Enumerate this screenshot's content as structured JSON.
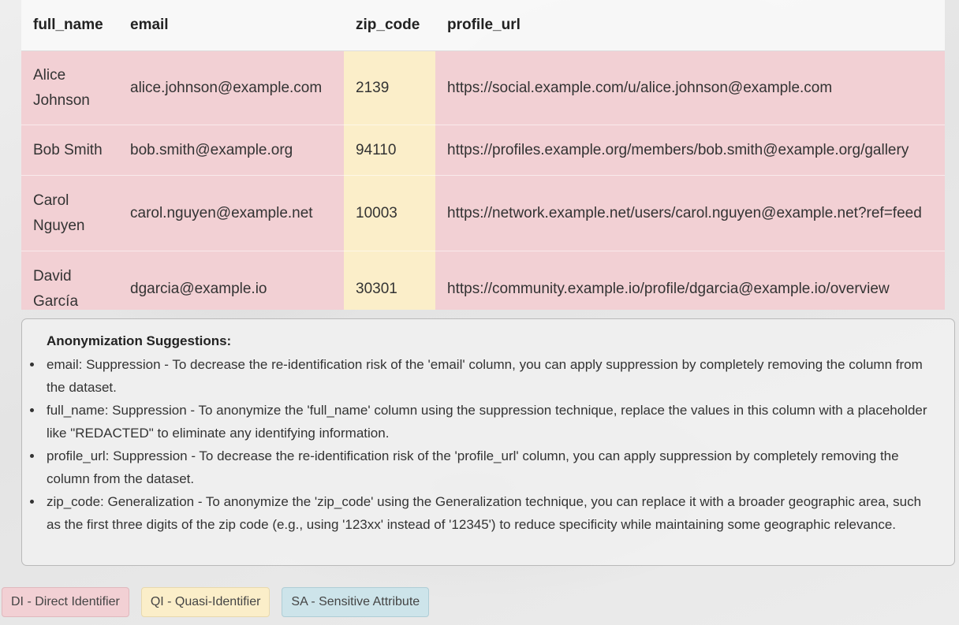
{
  "table": {
    "headers": [
      "full_name",
      "email",
      "zip_code",
      "profile_url"
    ],
    "rows": [
      [
        "Alice Johnson",
        "alice.johnson@example.com",
        "2139",
        "https://social.example.com/u/alice.johnson@example.com"
      ],
      [
        "Bob Smith",
        "bob.smith@example.org",
        "94110",
        "https://profiles.example.org/members/bob.smith@example.org/gallery"
      ],
      [
        "Carol Nguyen",
        "carol.nguyen@example.net",
        "10003",
        "https://network.example.net/users/carol.nguyen@example.net?ref=feed"
      ],
      [
        "David García",
        "dgarcia@example.io",
        "30301",
        "https://community.example.io/profile/dgarcia@example.io/overview"
      ]
    ],
    "column_types": [
      "DI",
      "DI",
      "QI",
      "DI"
    ]
  },
  "suggestions": {
    "title": "Anonymization Suggestions:",
    "items": [
      "email: Suppression - To decrease the re-identification risk of the 'email' column, you can apply suppression by completely removing the column from the dataset.",
      "full_name: Suppression - To anonymize the 'full_name' column using the suppression technique, replace the values in this column with a placeholder like \"REDACTED\" to eliminate any identifying information.",
      "profile_url: Suppression - To decrease the re-identification risk of the 'profile_url' column, you can apply suppression by completely removing the column from the dataset.",
      "zip_code: Generalization - To anonymize the 'zip_code' using the Generalization technique, you can replace it with a broader geographic area, such as the first three digits of the zip code (e.g., using '123xx' instead of '12345') to reduce specificity while maintaining some geographic relevance."
    ]
  },
  "legend": {
    "di": "DI - Direct Identifier",
    "qi": "QI - Quasi-Identifier",
    "sa": "SA - Sensitive Attribute"
  },
  "colors": {
    "di": "#f2d0d4",
    "qi": "#fbeec9",
    "sa": "#cde4ea"
  }
}
